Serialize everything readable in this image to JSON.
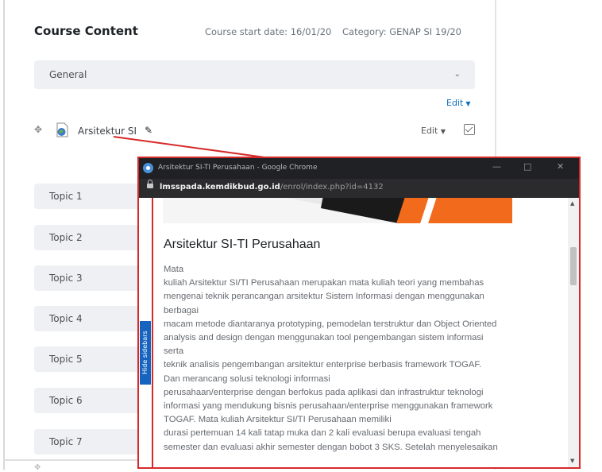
{
  "course": {
    "title": "Course Content",
    "start_date": "Course start date: 16/01/20",
    "category": "Category: GENAP SI 19/20"
  },
  "general_section": {
    "label": "General",
    "edit_label": "Edit"
  },
  "activity": {
    "name": "Arsitektur SI",
    "edit_label": "Edit",
    "icon": "page-icon"
  },
  "topics": [
    {
      "label": "Topic 1"
    },
    {
      "label": "Topic 2"
    },
    {
      "label": "Topic 3"
    },
    {
      "label": "Topic 4"
    },
    {
      "label": "Topic 5"
    },
    {
      "label": "Topic 6"
    },
    {
      "label": "Topic 7"
    }
  ],
  "popup": {
    "window_title": "Arsitektur SI-TI Perusahaan - Google Chrome",
    "url_domain": "lmsspada.kemdikbud.go.id",
    "url_path": "/enrol/index.php?id=4132",
    "hide_sidebars": "Hide sidebars",
    "heading": "Arsitektur SI-TI Perusahaan",
    "description_lines": [
      "Mata",
      "kuliah Arsitektur SI/TI Perusahaan merupakan mata kuliah teori yang membahas",
      "mengenai teknik perancangan arsitektur Sistem Informasi dengan menggunakan",
      "berbagai",
      "macam metode diantaranya prototyping, pemodelan terstruktur dan Object Oriented",
      "analysis and design dengan menggunakan tool pengembangan sistem informasi",
      "serta",
      "teknik analisis pengembangan arsitektur enterprise berbasis framework TOGAF.",
      "Dan merancang solusi teknologi informasi",
      "perusahaan/enterprise dengan berfokus pada aplikasi dan infrastruktur teknologi",
      "informasi yang mendukung bisnis perusahaan/enterprise menggunakan framework",
      "TOGAF. Mata  kuliah Arsitektur SI/TI Perusahaan memiliki",
      "durasi pertemuan 14 kali tatap muka dan 2 kali evaluasi berupa evaluasi tengah",
      "semester dan evaluasi akhir semester dengan bobot 3 SKS. Setelah menyelesaikan"
    ]
  },
  "colors": {
    "highlight": "#d62a2a",
    "link": "#0f6cbf",
    "sidebar_button": "#1565c0",
    "banner_orange": "#f26a1b"
  }
}
